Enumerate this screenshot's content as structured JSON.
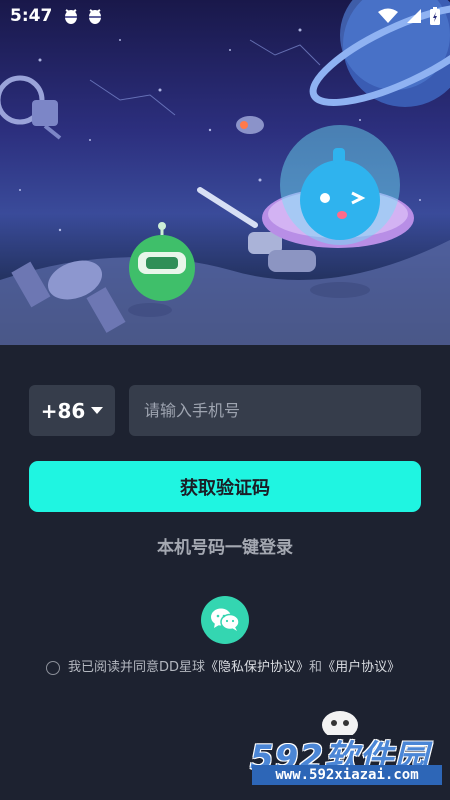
{
  "status_bar": {
    "time": "5:47",
    "notification_icons": [
      "bug-icon",
      "bug-icon"
    ],
    "right_icons": [
      "wifi-icon",
      "signal-icon",
      "battery-icon"
    ]
  },
  "login": {
    "country_code": "+86",
    "phone_placeholder": "请输入手机号",
    "phone_value": "",
    "get_code_label": "获取验证码",
    "one_click_label": "本机号码一键登录",
    "wechat_icon": "wechat-icon"
  },
  "agreement": {
    "prefix": "我已阅读并同意DD星球",
    "privacy_link": "《隐私保护协议》",
    "conjunction": "和",
    "user_link": "《用户协议》",
    "checked": false
  },
  "watermark": {
    "logo": "592软件园",
    "url": "www.592xiazai.com"
  },
  "colors": {
    "background": "#1d2230",
    "accent": "#1ff5e1",
    "field": "#363d4b",
    "wechat": "#34d6b1"
  }
}
